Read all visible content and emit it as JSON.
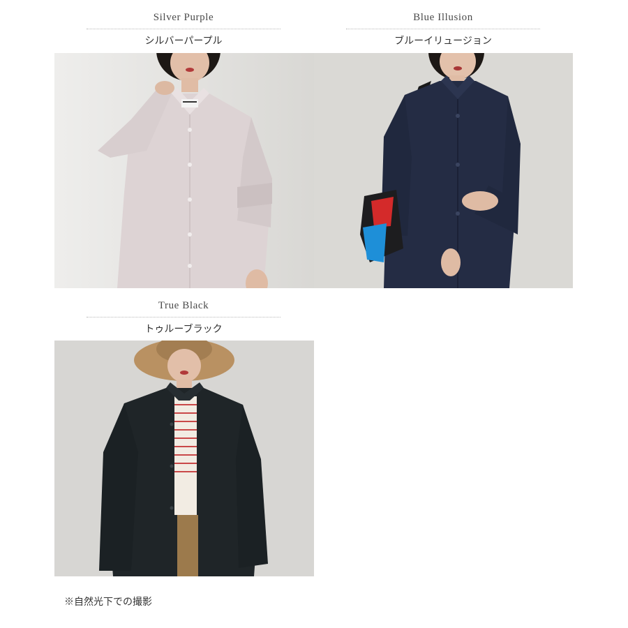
{
  "colors": [
    {
      "name_en": "Silver Purple",
      "name_ja": "シルバーパープル",
      "photo_alt": "Silver Purple shirt photo",
      "shirt_color": "#ddd3d4",
      "background_color": "#e2e1de"
    },
    {
      "name_en": "Blue Illusion",
      "name_ja": "ブルーイリュージョン",
      "photo_alt": "Blue Illusion shirt photo",
      "shirt_color": "#242c44",
      "background_color": "#d9d8d4"
    },
    {
      "name_en": "True Black",
      "name_ja": "トゥルーブラック",
      "photo_alt": "True Black shirt photo",
      "shirt_color": "#1f2528",
      "background_color": "#d6d5d2"
    }
  ],
  "footnote": "※自然光下での撮影"
}
